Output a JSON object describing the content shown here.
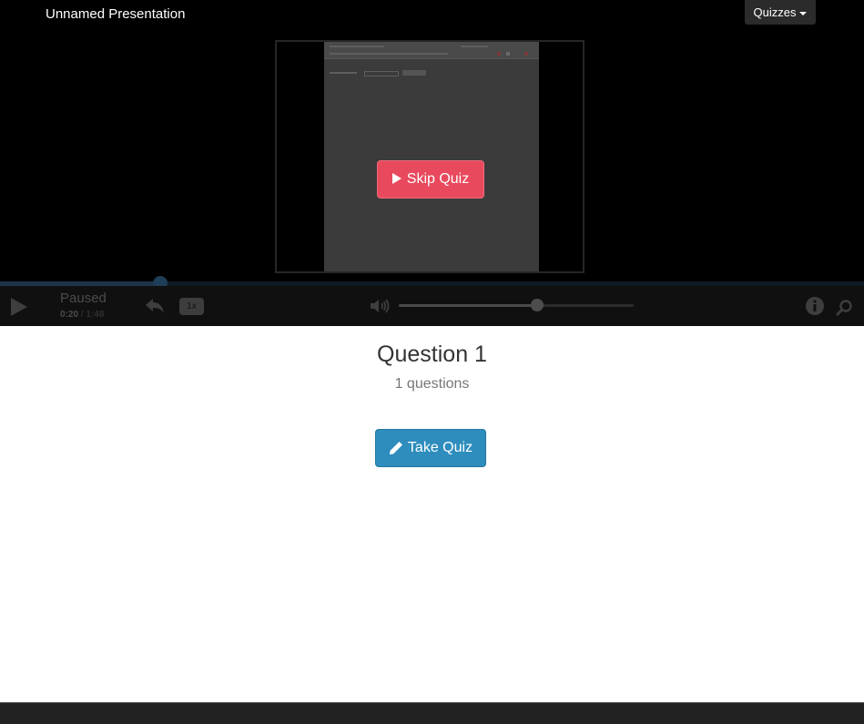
{
  "header": {
    "title": "Unnamed Presentation",
    "quizzes_label": "Quizzes"
  },
  "video": {
    "skip_label": "Skip Quiz"
  },
  "player": {
    "status": "Paused",
    "time_current": "0:20",
    "time_separator": "/",
    "time_total": "1:48",
    "progress_fraction": 0.185,
    "speed_label": "1x",
    "volume_fraction": 0.59
  },
  "quiz": {
    "title": "Question 1",
    "count": "1 questions",
    "take_label": "Take Quiz"
  },
  "icons": {
    "play": "play-icon",
    "rewind": "reply-arrow-icon",
    "volume": "volume-icon",
    "info": "info-icon",
    "search": "search-icon",
    "pencil": "pencil-icon"
  },
  "colors": {
    "skip_button": "#e8495d",
    "take_button": "#2e8dbd",
    "player_background": "#000000"
  }
}
